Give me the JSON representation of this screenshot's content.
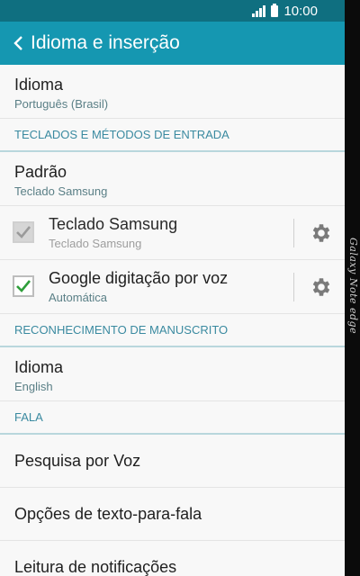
{
  "statusbar": {
    "time": "10:00",
    "signal_icon": "signal-icon",
    "battery_icon": "battery-icon"
  },
  "appbar": {
    "title": "Idioma e inserção",
    "back_icon": "chevron-left-icon"
  },
  "language": {
    "title": "Idioma",
    "value": "Português (Brasil)"
  },
  "keyboards_section": {
    "label": "TECLADOS E MÉTODOS DE ENTRADA"
  },
  "default_keyboard": {
    "title": "Padrão",
    "value": "Teclado Samsung"
  },
  "samsung_keyboard": {
    "title": "Teclado Samsung",
    "subtitle": "Teclado Samsung",
    "checked": true,
    "disabled": true
  },
  "google_voice": {
    "title": "Google digitação por voz",
    "subtitle": "Automática",
    "checked": true,
    "disabled": false
  },
  "handwriting_section": {
    "label": "RECONHECIMENTO DE MANUSCRITO"
  },
  "handwriting_language": {
    "title": "Idioma",
    "value": "English"
  },
  "speech_section": {
    "label": "FALA"
  },
  "voice_search": {
    "title": "Pesquisa por Voz"
  },
  "tts_options": {
    "title": "Opções de texto-para-fala"
  },
  "notification_reading": {
    "title": "Leitura de notificações"
  },
  "edge_brand": {
    "text": "Galaxy Note edge"
  },
  "colors": {
    "statusbar": "#0f6f80",
    "appbar": "#1597b1",
    "section_text": "#3a8aa0",
    "check_green": "#2e9e3a"
  }
}
